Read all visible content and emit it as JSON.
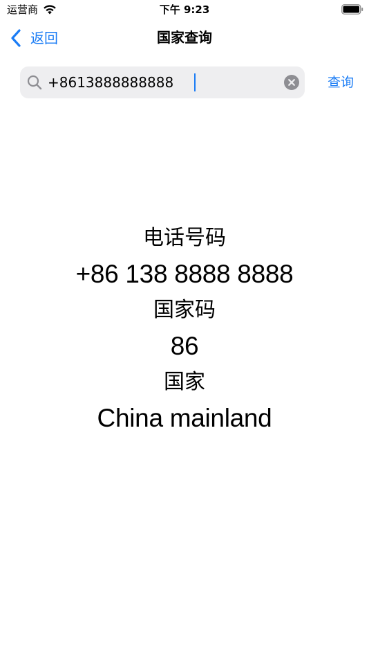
{
  "status_bar": {
    "carrier": "运营商",
    "time": "下午 9:23"
  },
  "nav": {
    "back_label": "返回",
    "title": "国家查询"
  },
  "search": {
    "value": "+8613888888888",
    "query_button": "查询"
  },
  "results": {
    "phone_label": "电话号码",
    "phone_value": "+86 138 8888 8888",
    "country_code_label": "国家码",
    "country_code_value": "86",
    "country_label": "国家",
    "country_value": "China mainland"
  },
  "colors": {
    "accent": "#1a7cf5",
    "search_bg": "#eeeef0",
    "icon_gray": "#8e8e93"
  }
}
